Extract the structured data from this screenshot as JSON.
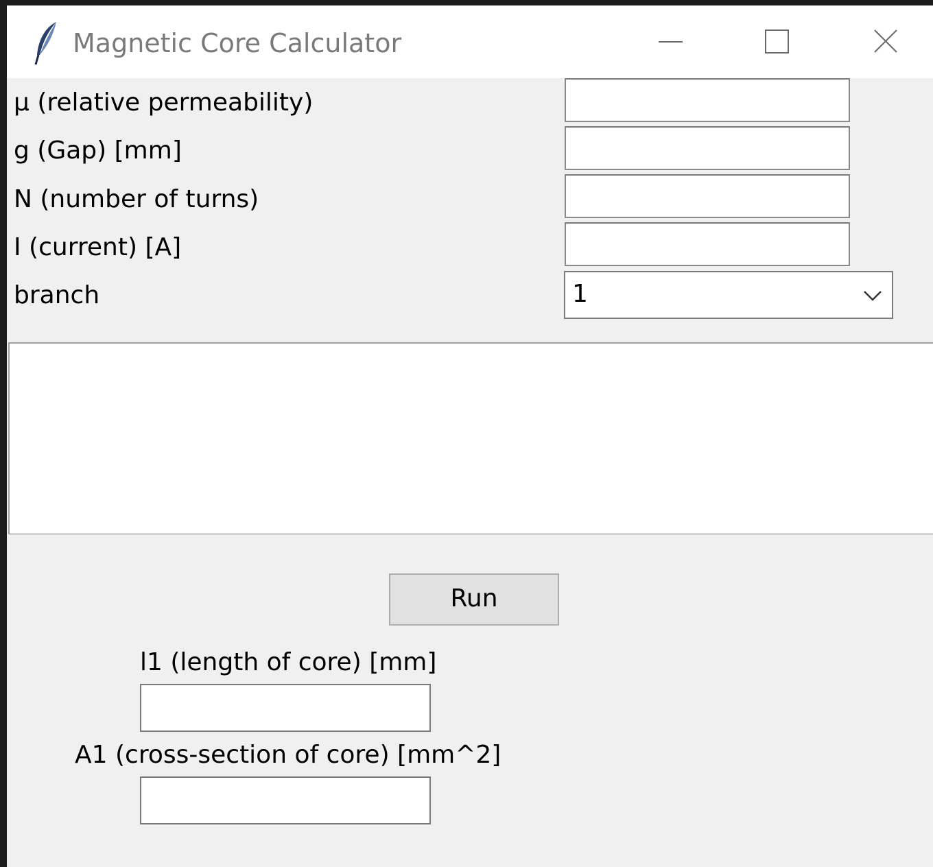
{
  "window": {
    "title": "Magnetic Core Calculator",
    "app_icon": "feather-icon",
    "controls": {
      "minimize_icon": "minimize-icon",
      "maximize_icon": "maximize-icon",
      "close_icon": "close-icon"
    }
  },
  "form": {
    "mu_label": "μ (relative permeability)",
    "mu_value": "",
    "gap_label": "g (Gap) [mm]",
    "gap_value": "",
    "turns_label": "N (number of turns)",
    "turns_value": "",
    "current_label": "I (current) [A]",
    "current_value": "",
    "branch_label": "branch",
    "branch_value": "1",
    "branch_arrow_icon": "chevron-down-icon"
  },
  "output": {
    "text": ""
  },
  "actions": {
    "run_label": "Run"
  },
  "core": {
    "length_label": "l1 (length of core) [mm]",
    "length_value": "",
    "area_label": "A1 (cross-section of core) [mm^2]",
    "area_value": ""
  },
  "colors": {
    "window_bg": "#f0f0f0",
    "titlebar_bg": "#ffffff",
    "button_bg": "#e1e1e1",
    "title_text": "#7a7a7a"
  }
}
